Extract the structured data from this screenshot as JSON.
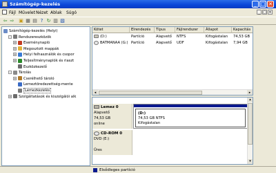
{
  "window": {
    "title": "Számítógép-kezelés",
    "min_glyph": "_",
    "max_glyph": "□",
    "close_glyph": "✕"
  },
  "menubar": {
    "items": [
      "Fájl",
      "Művelet",
      "Nézet",
      "Ablak",
      "Súgó"
    ],
    "mdi_min": "_",
    "mdi_max": "□",
    "mdi_close": "✕"
  },
  "toolbar": {
    "buttons": [
      "back-icon",
      "forward-icon",
      "up-icon",
      "show-tree-icon",
      "properties-icon",
      "help-icon",
      "refresh-icon",
      "export-icon",
      "help-book-icon"
    ]
  },
  "tree": {
    "items": [
      {
        "label": "Számítógép-kezelés (Helyi)",
        "level": 0,
        "expander": "",
        "icon": "computer-icon"
      },
      {
        "label": "Rendszereszközök",
        "level": 1,
        "expander": "-",
        "icon": "tools-icon"
      },
      {
        "label": "Eseménynapló",
        "level": 2,
        "expander": "+",
        "icon": "event-log-icon"
      },
      {
        "label": "Megosztott mappák",
        "level": 2,
        "expander": "+",
        "icon": "shared-folder-icon"
      },
      {
        "label": "Helyi felhasználók és csopor",
        "level": 2,
        "expander": "+",
        "icon": "users-icon"
      },
      {
        "label": "Teljesítménynaplók és riaszt",
        "level": 2,
        "expander": "+",
        "icon": "performance-icon"
      },
      {
        "label": "Eszközkezelő",
        "level": 2,
        "expander": "",
        "icon": "device-manager-icon"
      },
      {
        "label": "Tárolás",
        "level": 1,
        "expander": "-",
        "icon": "storage-icon"
      },
      {
        "label": "Cserélhető tároló",
        "level": 2,
        "expander": "+",
        "icon": "removable-storage-icon"
      },
      {
        "label": "Lemeztöredezettség-mente",
        "level": 2,
        "expander": "",
        "icon": "defrag-icon"
      },
      {
        "label": "Lemezkezelés",
        "level": 2,
        "expander": "",
        "icon": "disk-management-icon",
        "selected": true
      },
      {
        "label": "Szolgáltatások és kiszolgálói alk",
        "level": 1,
        "expander": "+",
        "icon": "services-icon"
      }
    ]
  },
  "volumes": {
    "columns": [
      "Kötet",
      "Elrendezés",
      "Típus",
      "Fájlrendszer",
      "Állapot",
      "Kapacitás"
    ],
    "rows": [
      {
        "name": "(D:)",
        "layout": "Partíció",
        "type": "Alapvető",
        "fs": "NTFS",
        "status": "Kifogástalan",
        "capacity": "74,53 GB"
      },
      {
        "name": "BATMANAA (G:)",
        "layout": "Partíció",
        "type": "Alapvető",
        "fs": "UDF",
        "status": "Kifogástalan",
        "capacity": "7,94 GB"
      }
    ]
  },
  "disks": [
    {
      "name": "Lemez 0",
      "type": "Alapvető",
      "size": "74,53 GB",
      "state": "online",
      "partition": {
        "name": "(D:)",
        "detail": "74,53 GB NTFS",
        "status": "Kifogástalan"
      }
    },
    {
      "name": "CD-ROM 0",
      "type": "DVD (E:)",
      "size": "",
      "state": "Üres"
    }
  ],
  "legend": {
    "label": "Elsődleges partíció",
    "color": "#0b1a8f"
  },
  "colors": {
    "titlebar": "#0a46d8",
    "partition_stripe": "#0b1a8f",
    "selection": "#316ac5"
  }
}
